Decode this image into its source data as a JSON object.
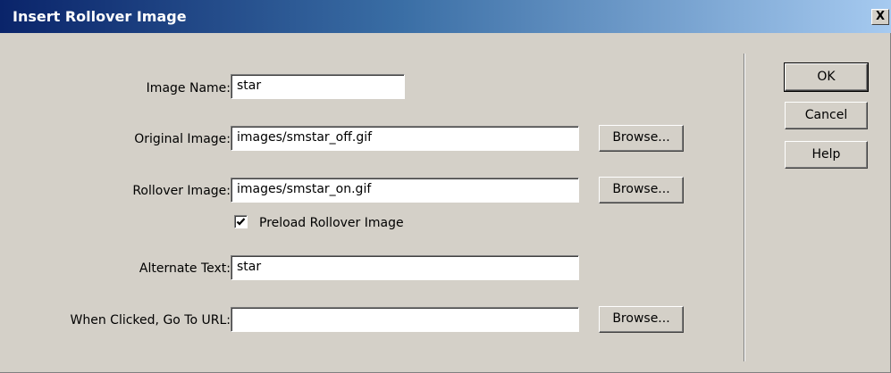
{
  "window": {
    "title": "Insert Rollover Image",
    "close_glyph": "X"
  },
  "form": {
    "image_name": {
      "label": "Image Name:",
      "value": "star"
    },
    "original_image": {
      "label": "Original Image:",
      "value": "images/smstar_off.gif",
      "browse_label": "Browse..."
    },
    "rollover_image": {
      "label": "Rollover Image:",
      "value": "images/smstar_on.gif",
      "browse_label": "Browse..."
    },
    "preload": {
      "label": "Preload Rollover Image",
      "checked": true
    },
    "alternate_text": {
      "label": "Alternate Text:",
      "value": "star"
    },
    "go_to_url": {
      "label": "When Clicked, Go To URL:",
      "value": "",
      "browse_label": "Browse..."
    }
  },
  "actions": {
    "ok_label": "OK",
    "cancel_label": "Cancel",
    "help_label": "Help"
  }
}
